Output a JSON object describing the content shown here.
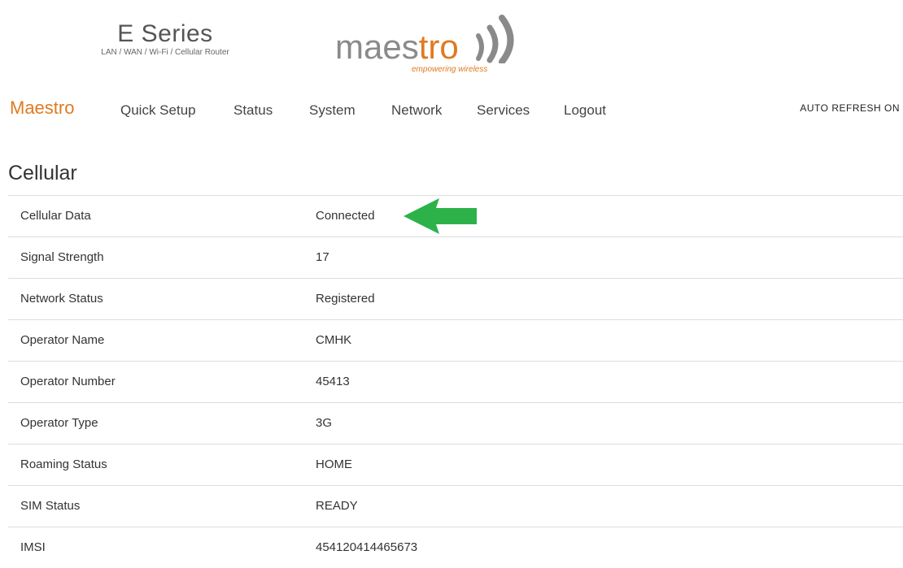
{
  "header": {
    "product_title": "E Series",
    "product_subtitle": "LAN / WAN / Wi-Fi / Cellular Router",
    "logo_word_start": "maes",
    "logo_word_accent": "tro",
    "logo_tagline": "empowering wireless"
  },
  "nav": {
    "brand": "Maestro",
    "items": [
      "Quick Setup",
      "Status",
      "System",
      "Network",
      "Services",
      "Logout"
    ],
    "auto_refresh": "AUTO REFRESH ON"
  },
  "section": {
    "title": "Cellular",
    "rows": [
      {
        "label": "Cellular Data",
        "value": "Connected"
      },
      {
        "label": "Signal Strength",
        "value": "17"
      },
      {
        "label": "Network Status",
        "value": "Registered"
      },
      {
        "label": "Operator Name",
        "value": "CMHK"
      },
      {
        "label": "Operator Number",
        "value": "45413"
      },
      {
        "label": "Operator Type",
        "value": "3G"
      },
      {
        "label": "Roaming Status",
        "value": "HOME"
      },
      {
        "label": "SIM Status",
        "value": "READY"
      },
      {
        "label": "IMSI",
        "value": "454120414465673"
      }
    ]
  },
  "annotation": {
    "arrow_color": "#2db24a",
    "arrow_icon": "left-arrow-icon"
  },
  "colors": {
    "brand_orange": "#e07a20",
    "text": "#333333",
    "divider": "#dddddd"
  }
}
